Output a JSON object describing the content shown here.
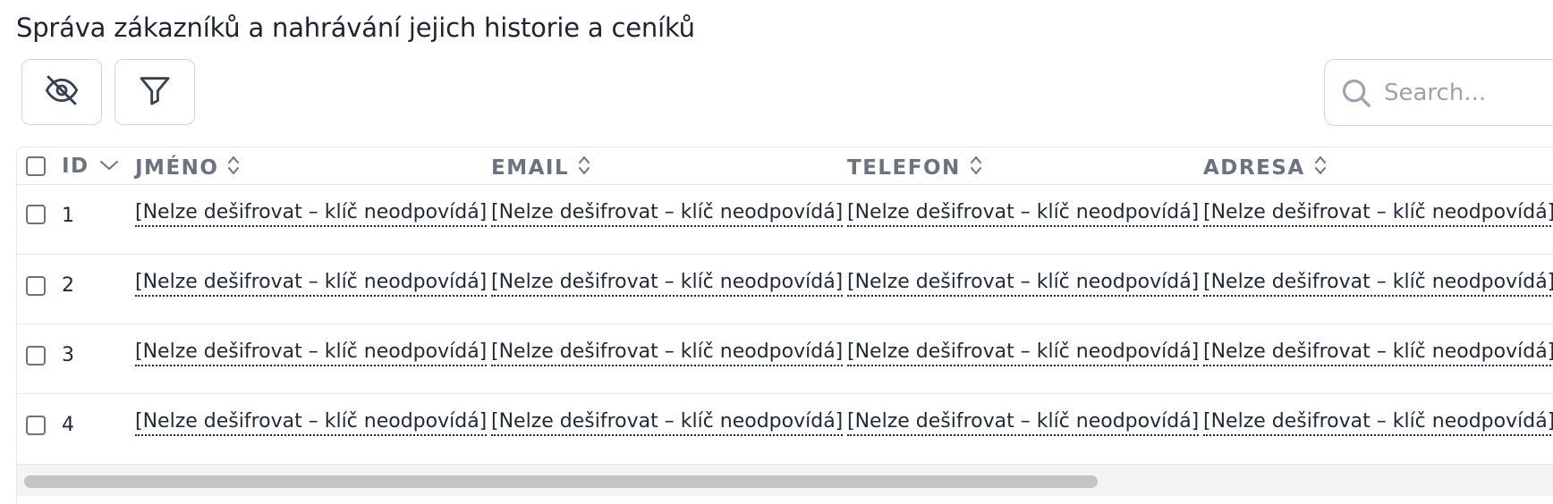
{
  "page": {
    "title": "Správa zákazníků a nahrávání jejich historie a ceníků"
  },
  "toolbar": {
    "hide_columns_icon": "eye-off-icon",
    "filter_icon": "filter-icon"
  },
  "search": {
    "placeholder": "Search...",
    "value": "",
    "icon": "search-icon"
  },
  "table": {
    "columns": [
      {
        "key": "id",
        "label": "ID",
        "sort": "desc"
      },
      {
        "key": "jmeno",
        "label": "JMÉNO",
        "sort": "none"
      },
      {
        "key": "email",
        "label": "EMAIL",
        "sort": "none"
      },
      {
        "key": "telefon",
        "label": "TELEFON",
        "sort": "none"
      },
      {
        "key": "adresa",
        "label": "ADRESA",
        "sort": "none"
      }
    ],
    "rows": [
      {
        "id": "1",
        "jmeno": "[Nelze dešifrovat – klíč neodpovídá]",
        "email": "[Nelze dešifrovat – klíč neodpovídá]",
        "telefon": "[Nelze dešifrovat – klíč neodpovídá]",
        "adresa": "[Nelze dešifrovat – klíč neodpovídá]"
      },
      {
        "id": "2",
        "jmeno": "[Nelze dešifrovat – klíč neodpovídá]",
        "email": "[Nelze dešifrovat – klíč neodpovídá]",
        "telefon": "[Nelze dešifrovat – klíč neodpovídá]",
        "adresa": "[Nelze dešifrovat – klíč neodpovídá]"
      },
      {
        "id": "3",
        "jmeno": "[Nelze dešifrovat – klíč neodpovídá]",
        "email": "[Nelze dešifrovat – klíč neodpovídá]",
        "telefon": "[Nelze dešifrovat – klíč neodpovídá]",
        "adresa": "[Nelze dešifrovat – klíč neodpovídá]"
      },
      {
        "id": "4",
        "jmeno": "[Nelze dešifrovat – klíč neodpovídá]",
        "email": "[Nelze dešifrovat – klíč neodpovídá]",
        "telefon": "[Nelze dešifrovat – klíč neodpovídá]",
        "adresa": "[Nelze dešifrovat – klíč neodpovídá]"
      }
    ]
  },
  "colors": {
    "border": "#d1d5db",
    "header_text": "#6b7280",
    "scroll_thumb": "#c4c4c4"
  }
}
